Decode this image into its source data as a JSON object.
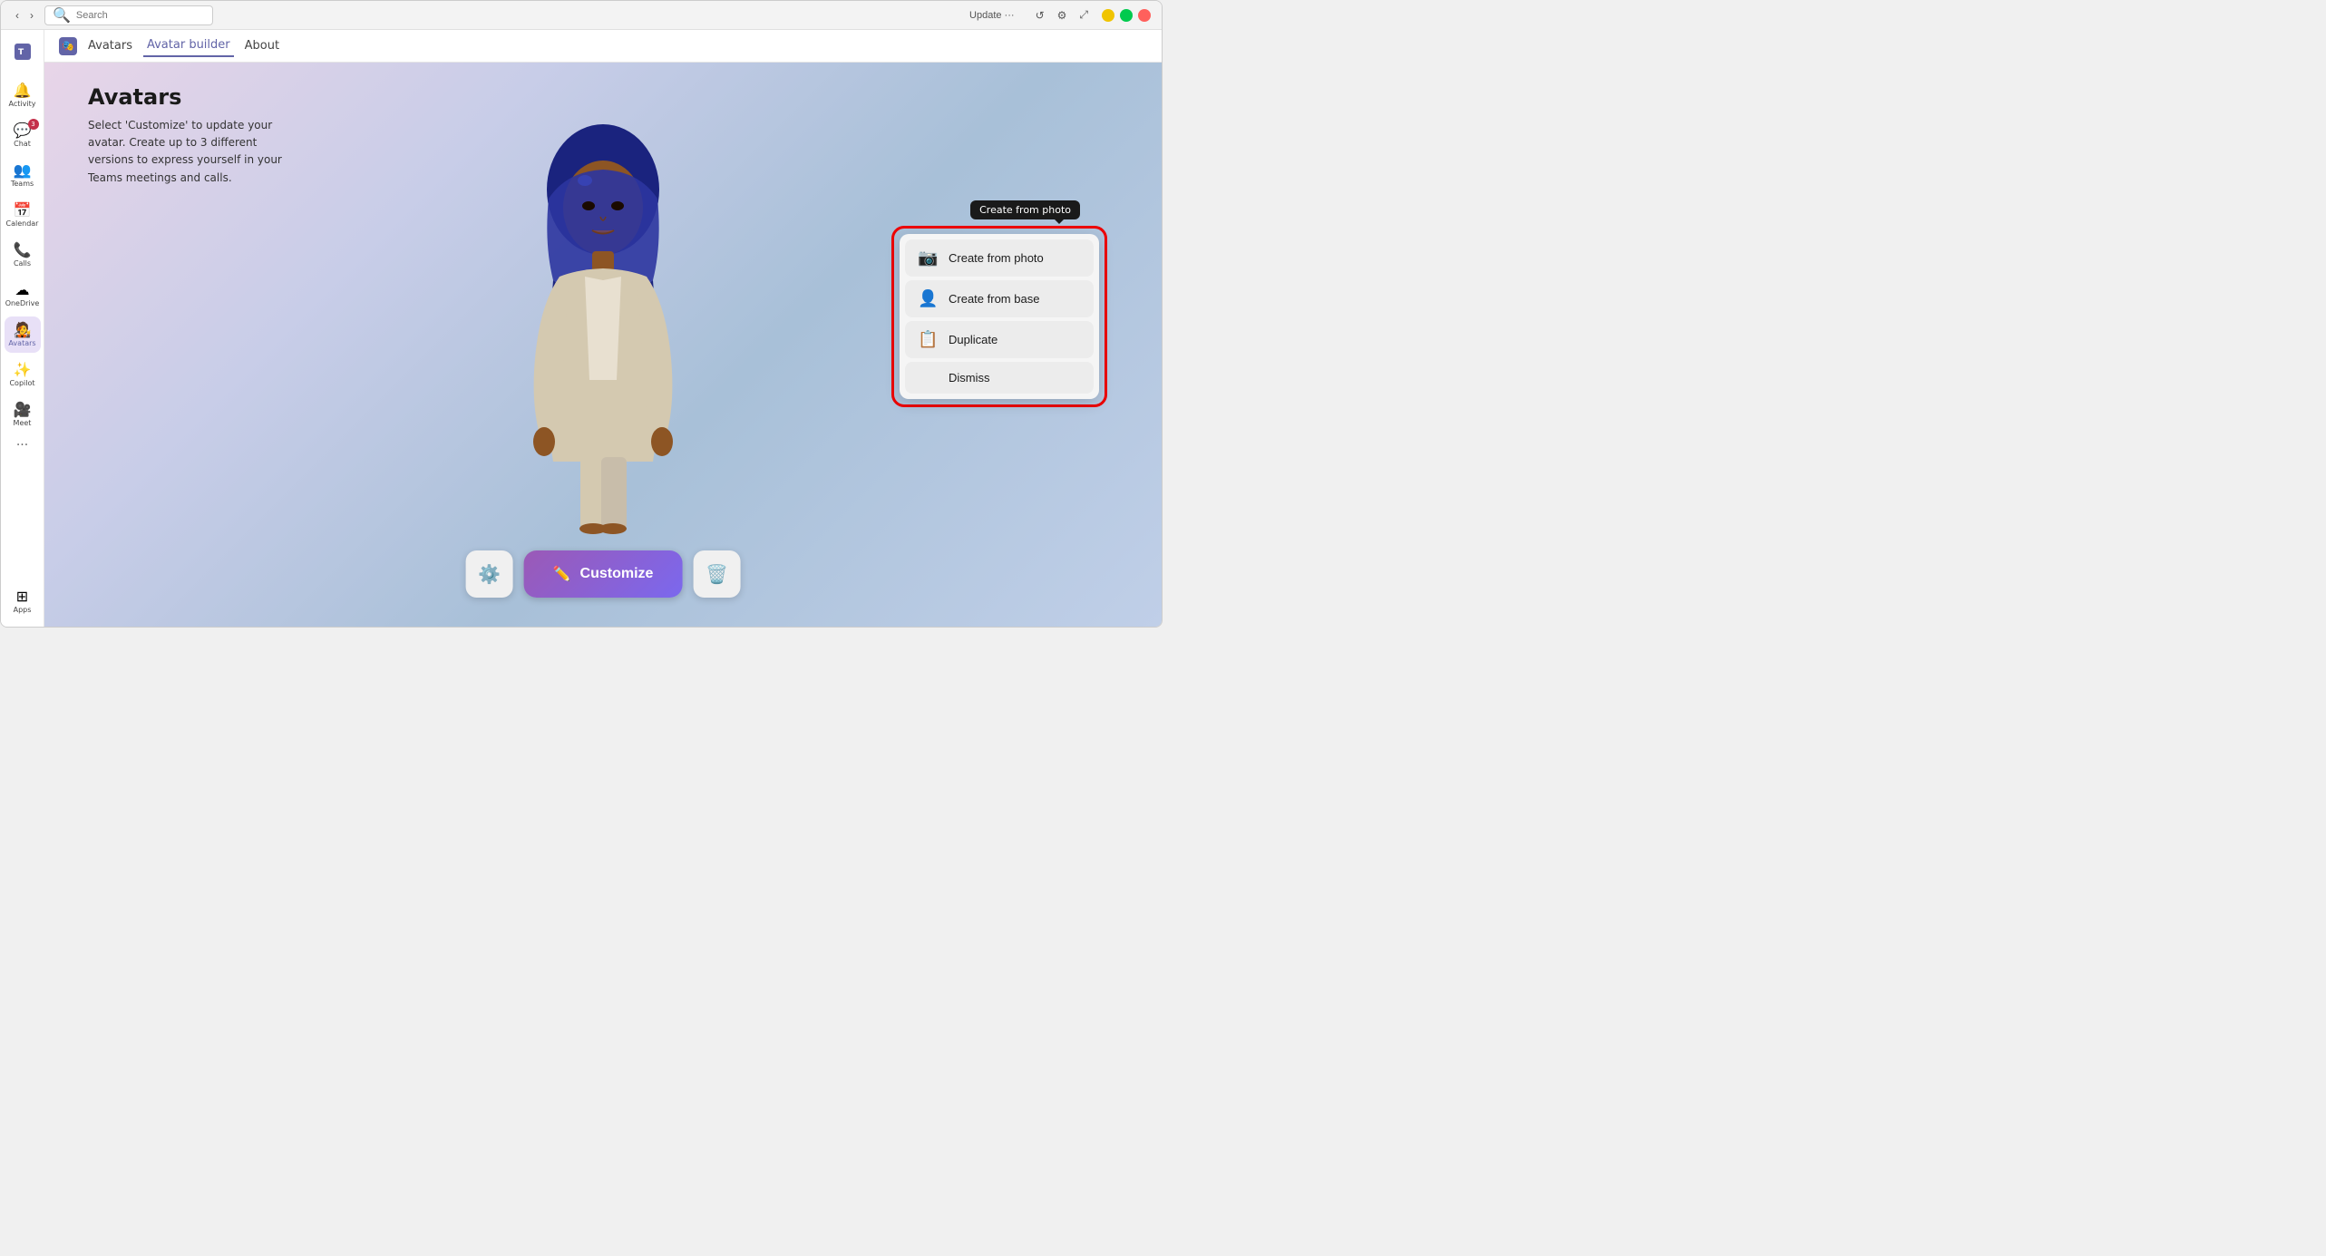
{
  "titleBar": {
    "appName": "Teams",
    "updateLabel": "Update ···",
    "searchPlaceholder": "Search",
    "windowControls": {
      "minimize": "—",
      "maximize": "▢",
      "close": "✕"
    }
  },
  "tabs": {
    "appIcon": "👤",
    "avatars": "Avatars",
    "avatarBuilder": "Avatar builder",
    "about": "About"
  },
  "page": {
    "title": "Avatars",
    "description": "Select 'Customize' to update your avatar. Create up to 3 different versions to express yourself in your Teams meetings and calls."
  },
  "sidebar": {
    "items": [
      {
        "id": "activity",
        "label": "Activity",
        "icon": "🔔",
        "badge": ""
      },
      {
        "id": "chat",
        "label": "Chat",
        "icon": "💬",
        "badge": "3"
      },
      {
        "id": "teams",
        "label": "Teams",
        "icon": "👥",
        "badge": ""
      },
      {
        "id": "calendar",
        "label": "Calendar",
        "icon": "📅",
        "badge": ""
      },
      {
        "id": "calls",
        "label": "Calls",
        "icon": "📞",
        "badge": ""
      },
      {
        "id": "onedrive",
        "label": "OneDrive",
        "icon": "☁",
        "badge": ""
      },
      {
        "id": "avatars",
        "label": "Avatars",
        "icon": "🧑‍🎤",
        "badge": "",
        "active": true
      },
      {
        "id": "copilot",
        "label": "Copilot",
        "icon": "✨",
        "badge": ""
      },
      {
        "id": "meet",
        "label": "Meet",
        "icon": "🎥",
        "badge": ""
      },
      {
        "id": "apps",
        "label": "Apps",
        "icon": "⊞",
        "badge": ""
      }
    ]
  },
  "bottomToolbar": {
    "settings_icon": "⚙",
    "customize_icon": "✏",
    "customize_label": "Customize",
    "delete_icon": "🗑"
  },
  "popupMenu": {
    "tooltip": "Create from photo",
    "items": [
      {
        "id": "create-from-photo",
        "icon": "📷",
        "label": "Create from photo"
      },
      {
        "id": "create-from-base",
        "icon": "👤",
        "label": "Create from base"
      },
      {
        "id": "duplicate",
        "icon": "📋",
        "label": "Duplicate"
      },
      {
        "id": "dismiss",
        "icon": "",
        "label": "Dismiss"
      }
    ]
  },
  "topRightIcons": {
    "refresh": "↺",
    "settings": "⚙",
    "popout": "⤢"
  }
}
